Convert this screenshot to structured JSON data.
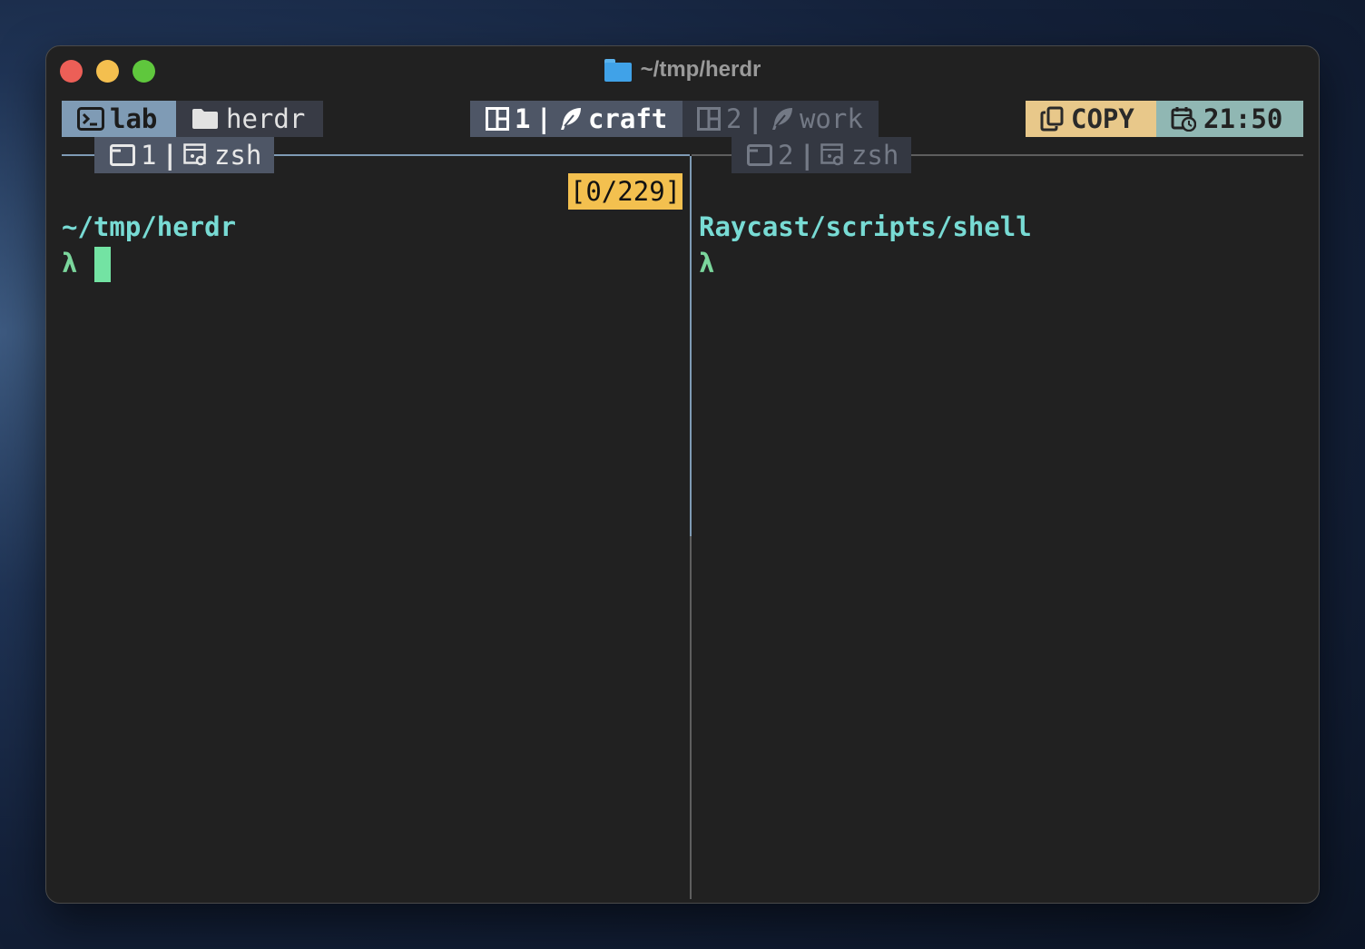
{
  "window": {
    "title": "~/tmp/herdr"
  },
  "statusbar": {
    "session": {
      "icon": "terminal-icon",
      "label": "lab"
    },
    "directory": {
      "icon": "folder-icon",
      "label": "herdr"
    },
    "workspaces": [
      {
        "index": "1",
        "name": "craft",
        "active": true,
        "icon": "layout-icon",
        "sub_icon": "feather-icon"
      },
      {
        "index": "2",
        "name": "work",
        "active": false,
        "icon": "layout-icon",
        "sub_icon": "feather-icon"
      }
    ],
    "mode": {
      "icon": "copy-icon",
      "label": "COPY"
    },
    "clock": {
      "icon": "calendar-clock-icon",
      "time": "21:50"
    },
    "separator": "|"
  },
  "panes": [
    {
      "tab_index": "1",
      "tab_label": "zsh",
      "active": true,
      "scroll_indicator": "[0/229]",
      "cwd": "~/tmp/herdr",
      "prompt_symbol": "λ"
    },
    {
      "tab_index": "2",
      "tab_label": "zsh",
      "active": false,
      "cwd": "Raycast/scripts/shell",
      "prompt_symbol": "λ"
    }
  ],
  "colors": {
    "active_border": "#7f9bb5",
    "inactive_border": "#5e5e5e",
    "path": "#78dbd4",
    "prompt": "#7bd69c",
    "cursor": "#73e3a3",
    "copy_mode": "#e8c88a",
    "clock": "#90b7b3",
    "scroll_indicator": "#f3c04f"
  }
}
